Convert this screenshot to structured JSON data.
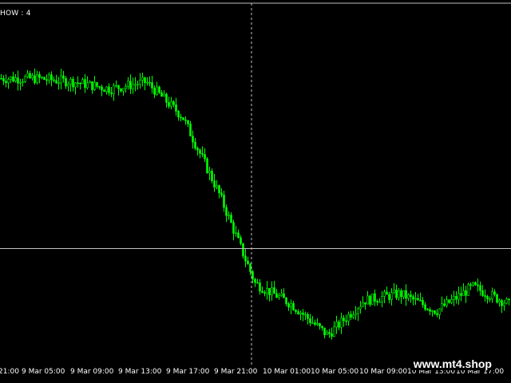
{
  "window": {
    "indicator_label": "HOW : 4",
    "watermark": "www.mt4.shop"
  },
  "colors": {
    "background": "#000000",
    "candle": "#00ff00",
    "axis_text": "#ffffff",
    "crosshair": "#c0c0c0"
  },
  "time_axis": {
    "labels": [
      "21:00",
      "9 Mar 05:00",
      "9 Mar 09:00",
      "9 Mar 13:00",
      "9 Mar 17:00",
      "9 Mar 21:00",
      "10 Mar 01:00",
      "10 Mar 05:00",
      "10 Mar 09:00",
      "10 Mar 13:00",
      "10 Mar 17:00"
    ]
  },
  "chart_data": {
    "type": "candlestick",
    "title": "",
    "xlabel": "",
    "ylabel": "",
    "ylim": [
      0,
      100
    ],
    "crosshair": {
      "time": "9 Mar 21:00",
      "value": 33
    },
    "x": [
      "21:00",
      "9 Mar 05:00",
      "9 Mar 09:00",
      "9 Mar 13:00",
      "9 Mar 17:00",
      "9 Mar 21:00",
      "10 Mar 01:00",
      "10 Mar 05:00",
      "10 Mar 09:00",
      "10 Mar 13:00",
      "10 Mar 17:00"
    ],
    "series": [
      {
        "values": [
          82,
          82,
          81,
          79,
          81,
          71,
          49,
          23,
          17,
          8,
          18,
          20,
          15,
          22,
          17
        ]
      }
    ]
  }
}
